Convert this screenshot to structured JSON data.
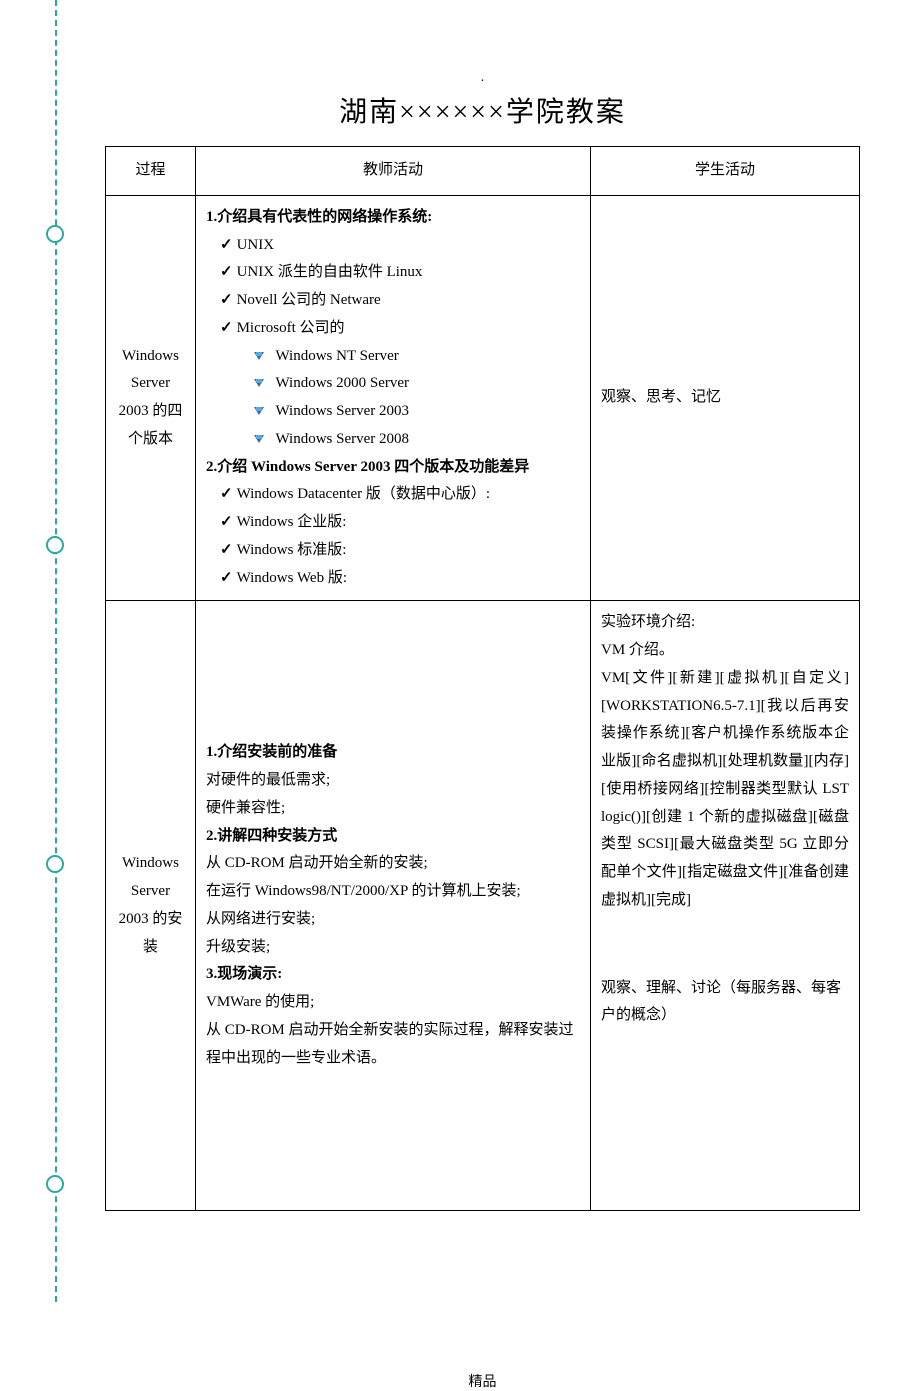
{
  "header": {
    "dot": ".",
    "title": "湖南××××××学院教案"
  },
  "table": {
    "headers": {
      "c1": "过程",
      "c2": "教师活动",
      "c3": "学生活动"
    },
    "row1": {
      "c1": "Windows Server 2003 的四个版本",
      "c2": {
        "h1": "1.介绍具有代表性的网络操作系统:",
        "i1": "UNIX",
        "i2": "UNIX 派生的自由软件 Linux",
        "i3": "Novell 公司的 Netware",
        "i4": "Microsoft 公司的",
        "s1": "Windows NT Server",
        "s2": "Windows 2000 Server",
        "s3": "Windows Server 2003",
        "s4": "Windows Server 2008",
        "h2": "2.介绍 Windows Server 2003 四个版本及功能差异",
        "j1": "Windows Datacenter 版（数据中心版）:",
        "j2": "Windows 企业版:",
        "j3": "Windows 标准版:",
        "j4": "Windows Web 版:"
      },
      "c3": "观察、思考、记忆"
    },
    "row2": {
      "c1": "Windows Server 2003 的安装",
      "c2": {
        "h1": "1.介绍安装前的准备",
        "l1": "对硬件的最低需求;",
        "l2": "硬件兼容性;",
        "h2": "2.讲解四种安装方式",
        "l3": "从 CD-ROM 启动开始全新的安装;",
        "l4": "在运行 Windows98/NT/2000/XP 的计算机上安装;",
        "l5": "从网络进行安装;",
        "l6": "升级安装;",
        "h3": "3.现场演示:",
        "l7": "VMWare 的使用;",
        "l8": "从 CD-ROM 启动开始全新安装的实际过程，解释安装过程中出现的一些专业术语。"
      },
      "c3": {
        "p1": "实验环境介绍:",
        "p2": "VM 介绍。",
        "p3": "VM[文件][新建][虚拟机][自定义][WORKSTATION6.5-7.1][我以后再安装操作系统][客户机操作系统版本企业版][命名虚拟机][处理机数量][内存][使用桥接网络][控制器类型默认 LST logic()][创建 1 个新的虚拟磁盘][磁盘类型 SCSI][最大磁盘类型 5G 立即分配单个文件][指定磁盘文件][准备创建虚拟机][完成]",
        "p4": "观察、理解、讨论（每服务器、每客户的概念）"
      }
    }
  },
  "footer": "精品"
}
